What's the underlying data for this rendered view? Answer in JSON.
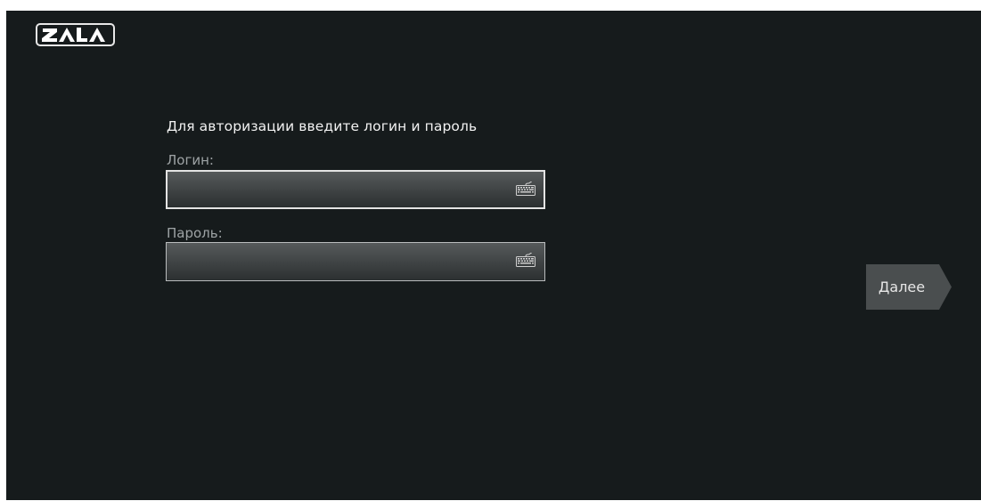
{
  "brand": {
    "logo_text": "ZALA"
  },
  "login_form": {
    "prompt": "Для авторизации введите логин и пароль",
    "login_label": "Логин:",
    "login_value": "",
    "password_label": "Пароль:",
    "password_value": "",
    "keyboard_icon": "keyboard-icon"
  },
  "actions": {
    "next_label": "Далее"
  },
  "colors": {
    "background": "#161b1c",
    "field_gradient_top": "#565a5b",
    "field_gradient_bottom": "#2c3031",
    "button": "#4a4e4f",
    "text": "#f2f2f2",
    "label": "#9ea3a5"
  }
}
